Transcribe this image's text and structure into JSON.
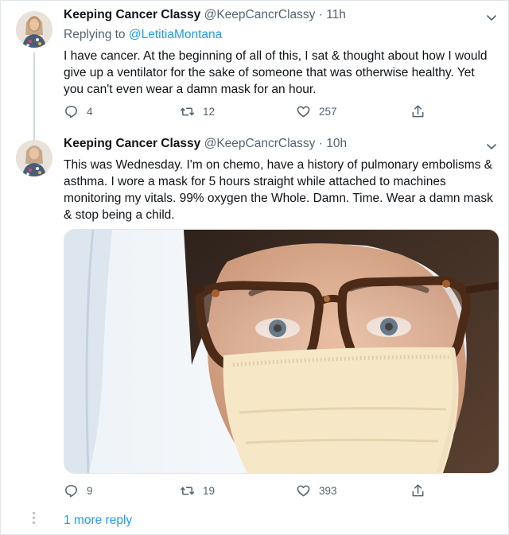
{
  "tweets": [
    {
      "name": "Keeping Cancer Classy",
      "handle": "@KeepCancrClassy",
      "separator": "·",
      "time": "11h",
      "replying_prefix": "Replying to ",
      "replying_to": "@LetitiaMontana",
      "text": "I have cancer. At the beginning of all of this, I sat & thought about how I would give up a ventilator for the sake of someone that was otherwise healthy. Yet you can't even wear a damn mask for an hour.",
      "replies": "4",
      "retweets": "12",
      "likes": "257"
    },
    {
      "name": "Keeping Cancer Classy",
      "handle": "@KeepCancrClassy",
      "separator": "·",
      "time": "10h",
      "text": "This was Wednesday. I'm on chemo, have a history of pulmonary embolisms & asthma. I wore a mask for 5 hours straight while attached to machines monitoring my vitals. 99% oxygen the Whole. Damn. Time. Wear a damn mask & stop being a child.",
      "replies": "9",
      "retweets": "19",
      "likes": "393"
    }
  ],
  "more_reply": "1 more reply",
  "icons": {
    "reply": "reply-icon",
    "retweet": "retweet-icon",
    "like": "heart-icon",
    "share": "share-icon",
    "more": "chevron-down-icon"
  },
  "colors": {
    "link": "#1d9bf0",
    "secondary_text": "#536471",
    "primary_text": "#0f1419",
    "border": "#e1e6ea"
  }
}
